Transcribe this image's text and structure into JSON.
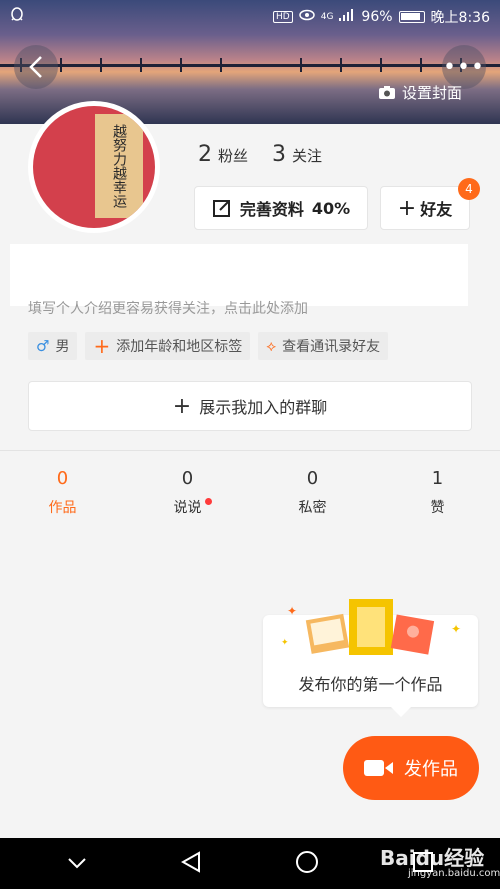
{
  "status_bar": {
    "hd": "HD",
    "signal": "4G",
    "battery": "96%",
    "time": "晚上8:36"
  },
  "header": {
    "set_cover_label": "设置封面",
    "more_label": "•••"
  },
  "avatar": {
    "text": "越努力越幸运"
  },
  "stats": {
    "fans_count": "2",
    "fans_label": "粉丝",
    "following_count": "3",
    "following_label": "关注"
  },
  "profile_button": {
    "label": "完善资料",
    "percent": "40%"
  },
  "friend_button": {
    "label": "好友",
    "badge": "4"
  },
  "bio_hint": "填写个人介绍更容易获得关注，点击此处添加",
  "tags": [
    {
      "icon": "♂",
      "label": "男"
    },
    {
      "icon": "+",
      "label": "添加年龄和地区标签"
    },
    {
      "icon": "⟡",
      "label": "查看通讯录好友"
    }
  ],
  "group_button": {
    "label": "展示我加入的群聊"
  },
  "tabs": [
    {
      "count": "0",
      "label": "作品"
    },
    {
      "count": "0",
      "label": "说说"
    },
    {
      "count": "0",
      "label": "私密"
    },
    {
      "count": "1",
      "label": "赞"
    }
  ],
  "prompt": {
    "text": "发布你的第一个作品"
  },
  "publish_button": {
    "label": "发作品"
  },
  "watermark": {
    "text": "Baidu经验",
    "sub": "jingyan.baidu.com"
  },
  "colors": {
    "accent": "#ff5a14",
    "badge": "#ff6a1a",
    "dot": "#ff3b3b"
  }
}
